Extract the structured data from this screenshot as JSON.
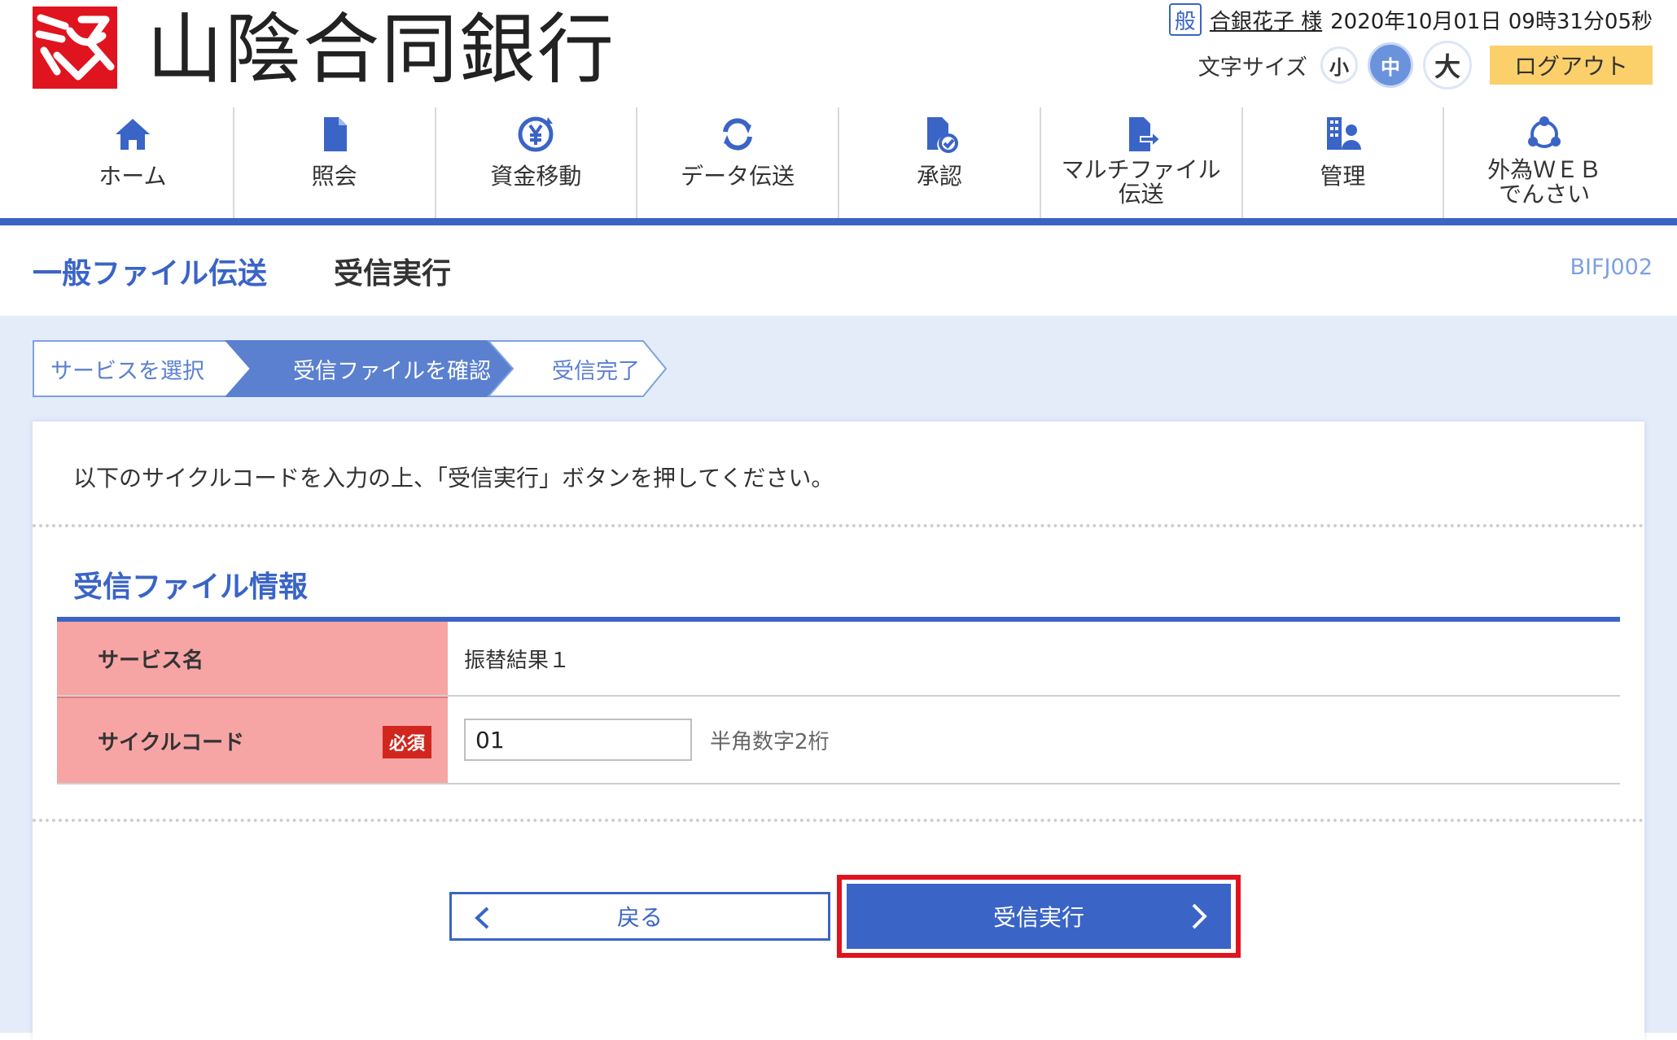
{
  "header": {
    "bank_name": "山陰合同銀行",
    "user_badge": "般",
    "user_name": "合銀花子 様",
    "datetime": "2020年10月01日 09時31分05秒",
    "font_size_label": "文字サイズ",
    "font_sizes": [
      "小",
      "中",
      "大"
    ],
    "logout_label": "ログアウト"
  },
  "nav": {
    "items": [
      {
        "label": "ホーム",
        "icon": "home-icon"
      },
      {
        "label": "照会",
        "icon": "document-icon"
      },
      {
        "label": "資金移動",
        "icon": "yen-transfer-icon"
      },
      {
        "label": "データ伝送",
        "icon": "sync-icon"
      },
      {
        "label": "承認",
        "icon": "approval-icon"
      },
      {
        "label": "マルチファイル\n伝送",
        "icon": "file-send-icon"
      },
      {
        "label": "管理",
        "icon": "management-icon"
      },
      {
        "label": "外為ＷＥＢ\nでんさい",
        "icon": "network-icon"
      }
    ]
  },
  "page": {
    "title": "一般ファイル伝送",
    "subtitle": "受信実行",
    "screen_id": "BIFJ002"
  },
  "steps": [
    "サービスを選択",
    "受信ファイルを確認",
    "受信完了"
  ],
  "instruction": "以下のサイクルコードを入力の上、「受信実行」ボタンを押してください。",
  "section": {
    "title": "受信ファイル情報",
    "rows": [
      {
        "label": "サービス名",
        "value": "振替結果１"
      },
      {
        "label": "サイクルコード",
        "required": "必須",
        "input_value": "01",
        "hint": "半角数字2桁"
      }
    ]
  },
  "buttons": {
    "back": "戻る",
    "execute": "受信実行"
  },
  "colors": {
    "primary": "#3a64c6",
    "accent_red": "#e0141f",
    "header_cell": "#f7a4a4",
    "logout": "#fbd06b",
    "background": "#e4ecfa"
  }
}
